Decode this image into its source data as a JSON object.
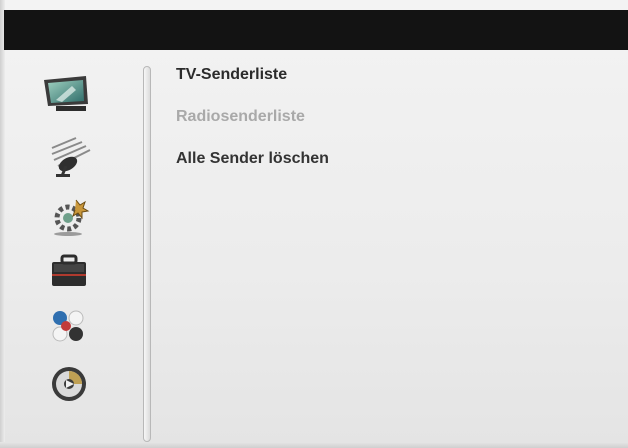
{
  "colors": {
    "top_bar": "#131313",
    "background": "#ececec",
    "text_primary": "#2b2b2b",
    "text_disabled": "#a9a9a9"
  },
  "sidebar": {
    "icons": [
      {
        "name": "tv-icon",
        "selected": true
      },
      {
        "name": "satellite-dish-icon",
        "selected": false
      },
      {
        "name": "settings-gear-icon",
        "selected": false
      },
      {
        "name": "toolbox-icon",
        "selected": false
      },
      {
        "name": "games-balls-icon",
        "selected": false
      },
      {
        "name": "media-disc-icon",
        "selected": false
      }
    ]
  },
  "menu": {
    "items": [
      {
        "label": "TV-Senderliste",
        "state": "highlighted"
      },
      {
        "label": "Radiosenderliste",
        "state": "disabled"
      },
      {
        "label": "Alle Sender löschen",
        "state": "normal"
      }
    ]
  }
}
